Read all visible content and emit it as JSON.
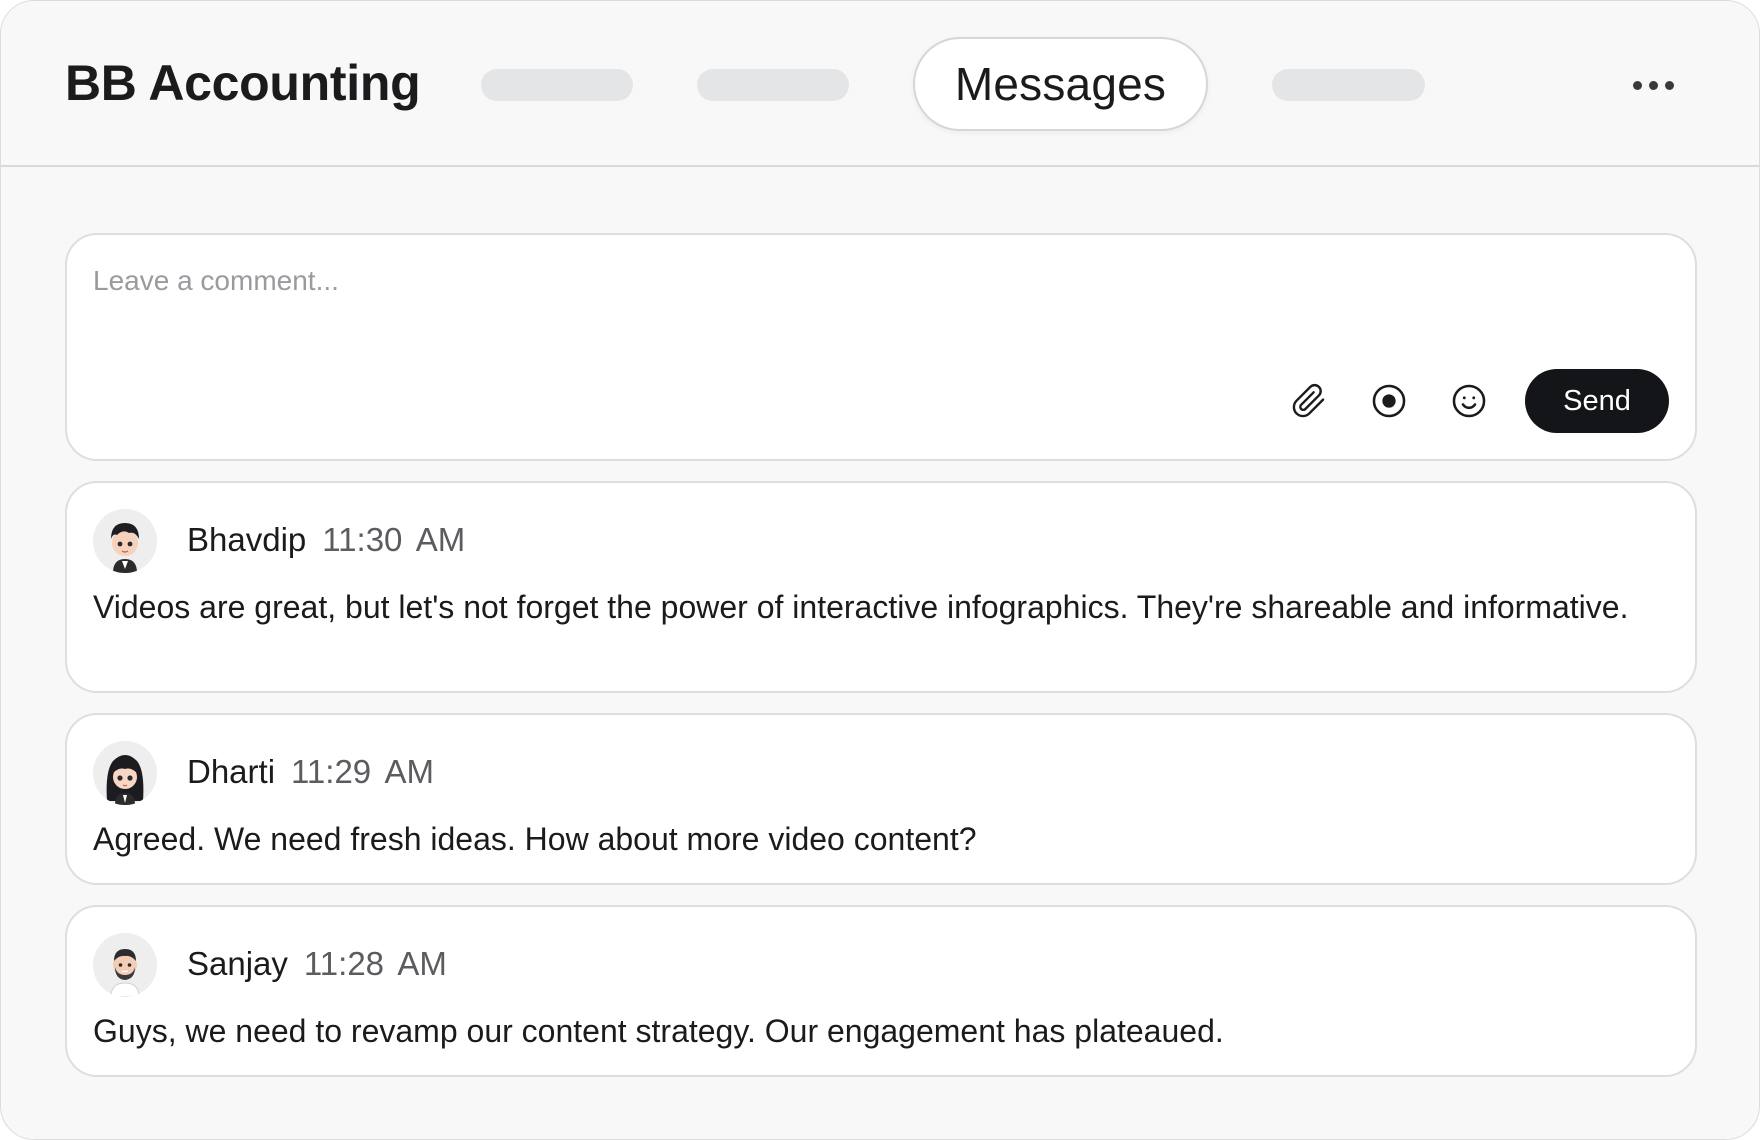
{
  "app": {
    "title": "BB Accounting"
  },
  "nav": {
    "active_tab_label": "Messages",
    "more_icon": "more-horizontal-icon"
  },
  "composer": {
    "placeholder": "Leave a comment...",
    "value": "",
    "tools": {
      "attach_icon": "paperclip-icon",
      "record_icon": "record-icon",
      "emoji_icon": "smiley-icon"
    },
    "send_label": "Send"
  },
  "messages": [
    {
      "author": "Bhavdip",
      "time": "11:30 AM",
      "text": "Videos are great, but let's not forget the power of interactive infographics. They're shareable and informative."
    },
    {
      "author": "Dharti",
      "time": "11:29 AM",
      "text": "Agreed. We need fresh ideas. How about more video content?"
    },
    {
      "author": "Sanjay",
      "time": "11:28 AM",
      "text": "Guys, we need to revamp our content strategy. Our engagement has plateaued."
    }
  ],
  "colors": {
    "background": "#f8f8f8",
    "card": "#ffffff",
    "border": "#dedede",
    "send_button": "#141518",
    "skeleton": "#e4e5e7"
  }
}
